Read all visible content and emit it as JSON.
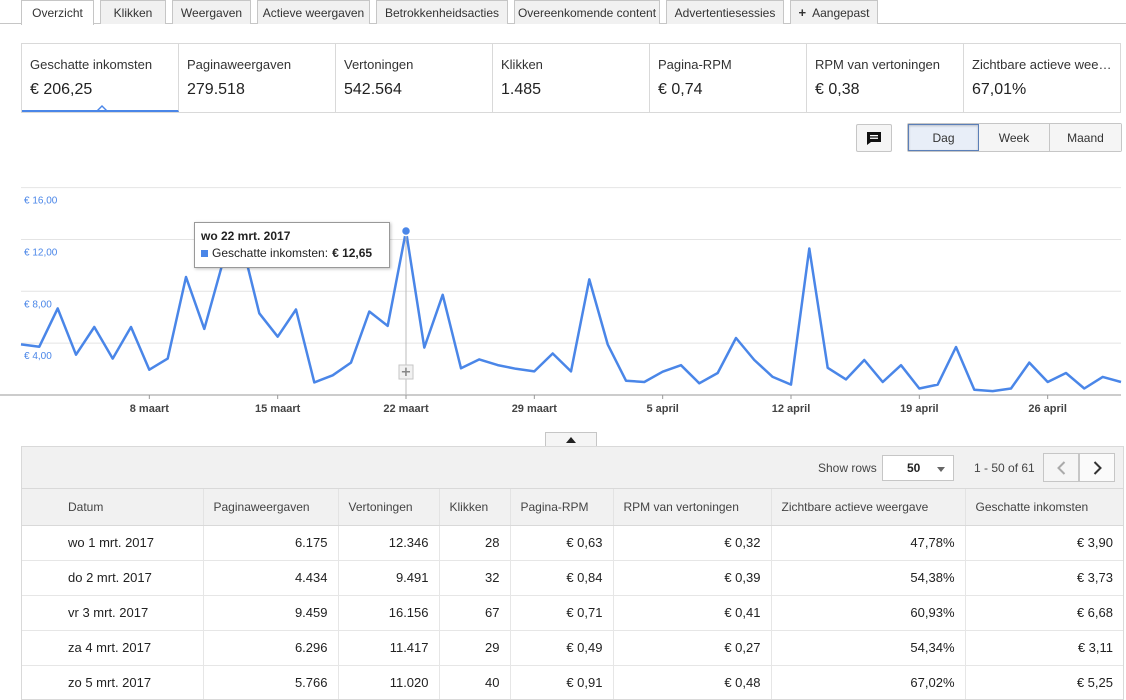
{
  "tabs": [
    {
      "label": "Overzicht",
      "active": true
    },
    {
      "label": "Klikken"
    },
    {
      "label": "Weergaven"
    },
    {
      "label": "Actieve weergaven"
    },
    {
      "label": "Betrokkenheidsacties"
    },
    {
      "label": "Overeenkomende content"
    },
    {
      "label": "Advertentiesessies"
    },
    {
      "label": "Aangepast"
    }
  ],
  "metrics": [
    {
      "label": "Geschatte inkomsten",
      "value": "€ 206,25",
      "active": true
    },
    {
      "label": "Paginaweergaven",
      "value": "279.518"
    },
    {
      "label": "Vertoningen",
      "value": "542.564"
    },
    {
      "label": "Klikken",
      "value": "1.485"
    },
    {
      "label": "Pagina-RPM",
      "value": "€ 0,74"
    },
    {
      "label": "RPM van vertoningen",
      "value": "€ 0,38"
    },
    {
      "label": "Zichtbare actieve wee…",
      "value": "67,01%"
    }
  ],
  "period": {
    "day": "Dag",
    "week": "Week",
    "month": "Maand",
    "selected": "Dag"
  },
  "chart_data": {
    "type": "line",
    "series": [
      {
        "name": "Geschatte inkomsten",
        "color": "#4a86e8",
        "values": [
          3.9,
          3.73,
          6.68,
          3.11,
          5.25,
          2.81,
          5.25,
          1.95,
          2.81,
          9.1,
          5.1,
          10.2,
          12.0,
          6.3,
          4.5,
          6.6,
          0.97,
          1.52,
          2.5,
          6.44,
          5.33,
          12.65,
          3.66,
          7.73,
          2.06,
          2.75,
          2.31,
          2.02,
          1.82,
          3.2,
          1.82,
          8.92,
          3.9,
          1.1,
          1.0,
          1.8,
          2.3,
          0.9,
          1.7,
          4.4,
          2.7,
          1.4,
          0.8,
          11.3,
          2.1,
          1.2,
          2.7,
          1.0,
          2.3,
          0.5,
          0.8,
          3.7,
          0.4,
          0.3,
          0.5,
          2.5,
          1.0,
          1.7,
          0.5,
          1.4,
          1.0
        ]
      }
    ],
    "x_tick_labels": [
      "8 maart",
      "15 maart",
      "22 maart",
      "29 maart",
      "5 april",
      "12 april",
      "19 april",
      "26 april"
    ],
    "y_tick_labels": [
      "€ 4,00",
      "€ 8,00",
      "€ 12,00",
      "€ 16,00"
    ],
    "ylim": [
      0,
      16
    ],
    "grid": true,
    "highlight_index": 21
  },
  "tooltip": {
    "date": "wo 22 mrt. 2017",
    "series": "Geschatte inkomsten:",
    "value": "€ 12,65"
  },
  "table": {
    "show_rows_label": "Show rows",
    "rows_per_page": "50",
    "range": "1 - 50 of 61",
    "columns": [
      "Datum",
      "Paginaweergaven",
      "Vertoningen",
      "Klikken",
      "Pagina-RPM",
      "RPM van vertoningen",
      "Zichtbare actieve weergave",
      "Geschatte inkomsten"
    ],
    "rows": [
      [
        "wo 1 mrt. 2017",
        "6.175",
        "12.346",
        "28",
        "€ 0,63",
        "€ 0,32",
        "47,78%",
        "€ 3,90"
      ],
      [
        "do 2 mrt. 2017",
        "4.434",
        "9.491",
        "32",
        "€ 0,84",
        "€ 0,39",
        "54,38%",
        "€ 3,73"
      ],
      [
        "vr 3 mrt. 2017",
        "9.459",
        "16.156",
        "67",
        "€ 0,71",
        "€ 0,41",
        "60,93%",
        "€ 6,68"
      ],
      [
        "za 4 mrt. 2017",
        "6.296",
        "11.417",
        "29",
        "€ 0,49",
        "€ 0,27",
        "54,34%",
        "€ 3,11"
      ],
      [
        "zo 5 mrt. 2017",
        "5.766",
        "11.020",
        "40",
        "€ 0,91",
        "€ 0,48",
        "67,02%",
        "€ 5,25"
      ]
    ]
  }
}
